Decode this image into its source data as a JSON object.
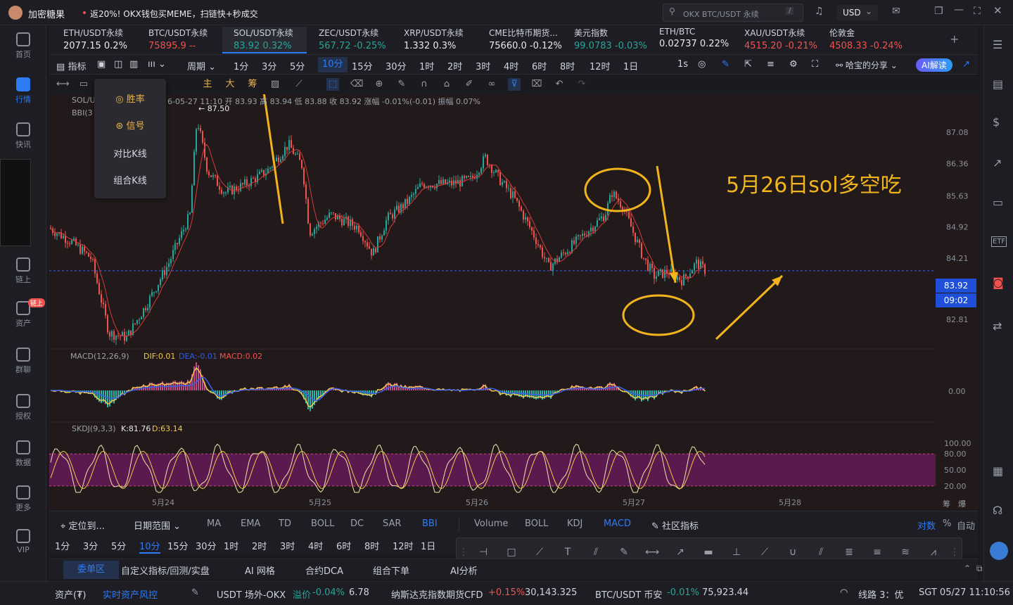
{
  "app": {
    "name": "加密糖果",
    "promo": "返20%! OKX钱包买MEME，扫链快+秒成交",
    "search_placeholder": "OKX BTC/USDT 永续",
    "search_shortcut": "/",
    "currency": "USD"
  },
  "leftnav": [
    {
      "label": "首页",
      "icon": "home-icon"
    },
    {
      "label": "行情",
      "icon": "chart-bar-icon",
      "active": true
    },
    {
      "label": "快讯",
      "icon": "news-icon"
    },
    {
      "label": "链上",
      "icon": "chain-icon"
    },
    {
      "label": "资产",
      "icon": "wallet-icon",
      "badge": "链上"
    },
    {
      "label": "群聊",
      "icon": "chat-icon"
    },
    {
      "label": "授权",
      "icon": "key-icon"
    },
    {
      "label": "数据",
      "icon": "data-icon"
    },
    {
      "label": "更多",
      "icon": "grid-icon"
    },
    {
      "label": "VIP",
      "icon": "vip-icon"
    }
  ],
  "tickers": [
    {
      "name": "ETH/USDT永续",
      "price": "2077.15",
      "change": "0.2%",
      "dir": "wh"
    },
    {
      "name": "BTC/USDT永续",
      "price": "75895.9",
      "change": "--",
      "dir": "dn"
    },
    {
      "name": "SOL/USDT永续",
      "price": "83.92",
      "change": "0.32%",
      "dir": "up",
      "active": true
    },
    {
      "name": "ZEC/USDT永续",
      "price": "567.72",
      "change": "-0.25%",
      "dir": "up"
    },
    {
      "name": "XRP/USDT永续",
      "price": "1.332",
      "change": "0.3%",
      "dir": "wh"
    },
    {
      "name": "CME比特币期货...",
      "price": "75660.0",
      "change": "-0.12%",
      "dir": "wh"
    },
    {
      "name": "美元指数",
      "price": "99.0783",
      "change": "-0.03%",
      "dir": "up"
    },
    {
      "name": "ETH/BTC",
      "price": "0.02737",
      "change": "0.22%",
      "dir": "wh"
    },
    {
      "name": "XAU/USDT永续",
      "price": "4515.20",
      "change": "-0.21%",
      "dir": "dn"
    },
    {
      "name": "伦敦金",
      "price": "4508.33",
      "change": "-0.24%",
      "dir": "dn"
    }
  ],
  "periodbar": {
    "indicator": "指标",
    "cycle": "周期",
    "periods": [
      "1分",
      "3分",
      "5分",
      "10分",
      "15分",
      "30分",
      "1时",
      "2时",
      "3时",
      "4时",
      "6时",
      "8时",
      "12时",
      "1日"
    ],
    "selected": "10分",
    "sec": "1s",
    "share": "哈宝的分享",
    "ai": "AI解读"
  },
  "drawbar": {
    "main": "主",
    "big": "大",
    "chip": "筹"
  },
  "popup": {
    "items": [
      "胜率",
      "信号",
      "对比K线",
      "组合K线"
    ]
  },
  "chart": {
    "symbol_line": "SOL/U",
    "bbi": "BBI(3",
    "ohlc": "6-05-27 11:10  开 83.93  高 83.94  低 83.88  收 83.92  涨幅 -0.01%(-0.01)  振幅 0.07%",
    "high_label": "← 87.50",
    "price_ticks": [
      "87.08",
      "86.36",
      "85.63",
      "84.92",
      "84.21",
      "83.51",
      "82.81"
    ],
    "last_price": "83.92",
    "countdown": "09:02",
    "annotation": "5月26日sol多空吃",
    "macd": {
      "label": "MACD(12,26,9)",
      "dif": "DIF:0.01",
      "dea": "DEA:-0.01",
      "macd": "MACD:0.02",
      "zero": "0.00"
    },
    "skdj": {
      "label": "SKDJ(9,3,3)",
      "k": "K:81.76",
      "d": "D:63.14",
      "ticks": [
        "100.00",
        "80.00",
        "50.00",
        "20.00"
      ]
    },
    "dates": [
      "5月24",
      "5月25",
      "5月26",
      "5月27",
      "5月28"
    ],
    "corner": [
      "筹",
      "爆"
    ]
  },
  "botnav": {
    "locate": "定位到...",
    "daterange": "日期范围",
    "indicators": [
      "MA",
      "EMA",
      "TD",
      "BOLL",
      "DC",
      "SAR",
      "BBI",
      "Volume",
      "BOLL",
      "KDJ",
      "MACD"
    ],
    "community": "社区指标",
    "log": "对数",
    "pct": "%",
    "auto": "自动"
  },
  "botperiod": [
    "1分",
    "3分",
    "5分",
    "10分",
    "15分",
    "30分",
    "1时",
    "2时",
    "3时",
    "4时",
    "6时",
    "8时",
    "12时",
    "1日"
  ],
  "ordertabs": [
    "委单区",
    "自定义指标/回测/实盘",
    "AI 网格",
    "合约DCA",
    "组合下单",
    "AI分析"
  ],
  "status": {
    "assets": "资产(₮)",
    "risk": "实时资产风控",
    "usdt": "USDT 场外-OKX",
    "premium_lbl": "溢价",
    "premium": "-0.04%",
    "usdt_price": "6.78",
    "nasdaq": "纳斯达克指数期货CFD",
    "nasdaq_chg": "+0.15%",
    "nasdaq_val": "30,143.325",
    "btc": "BTC/USDT 币安",
    "btc_chg": "-0.01%",
    "btc_val": "75,923.44",
    "line": "线路 3：优",
    "time": "SGT 05/27 11:10:56"
  }
}
